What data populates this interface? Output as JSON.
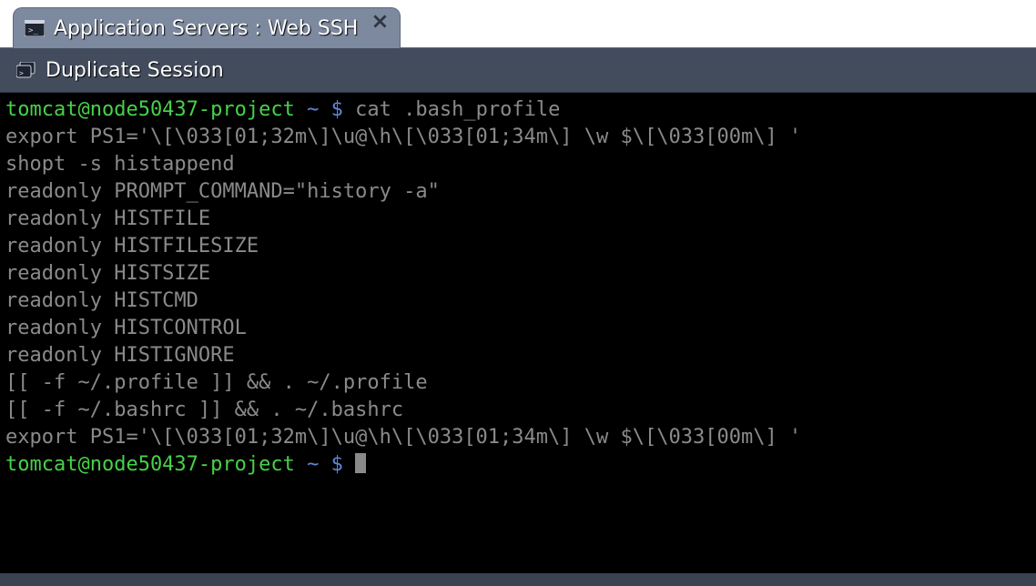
{
  "tab": {
    "title": "Application Servers : Web SSH"
  },
  "toolbar": {
    "duplicate_label": "Duplicate Session"
  },
  "terminal": {
    "prompt_user_host": "tomcat@node50437-project",
    "prompt_path": "~",
    "prompt_symbol": "$",
    "command1": "cat .bash_profile",
    "output_lines": [
      "export PS1='\\[\\033[01;32m\\]\\u@\\h\\[\\033[01;34m\\] \\w $\\[\\033[00m\\] '",
      "shopt -s histappend",
      "readonly PROMPT_COMMAND=\"history -a\"",
      "readonly HISTFILE",
      "readonly HISTFILESIZE",
      "readonly HISTSIZE",
      "readonly HISTCMD",
      "readonly HISTCONTROL",
      "readonly HISTIGNORE",
      "[[ -f ~/.profile ]] && . ~/.profile",
      "[[ -f ~/.bashrc ]] && . ~/.bashrc",
      "export PS1='\\[\\033[01;32m\\]\\u@\\h\\[\\033[01;34m\\] \\w $\\[\\033[00m\\] '"
    ]
  }
}
